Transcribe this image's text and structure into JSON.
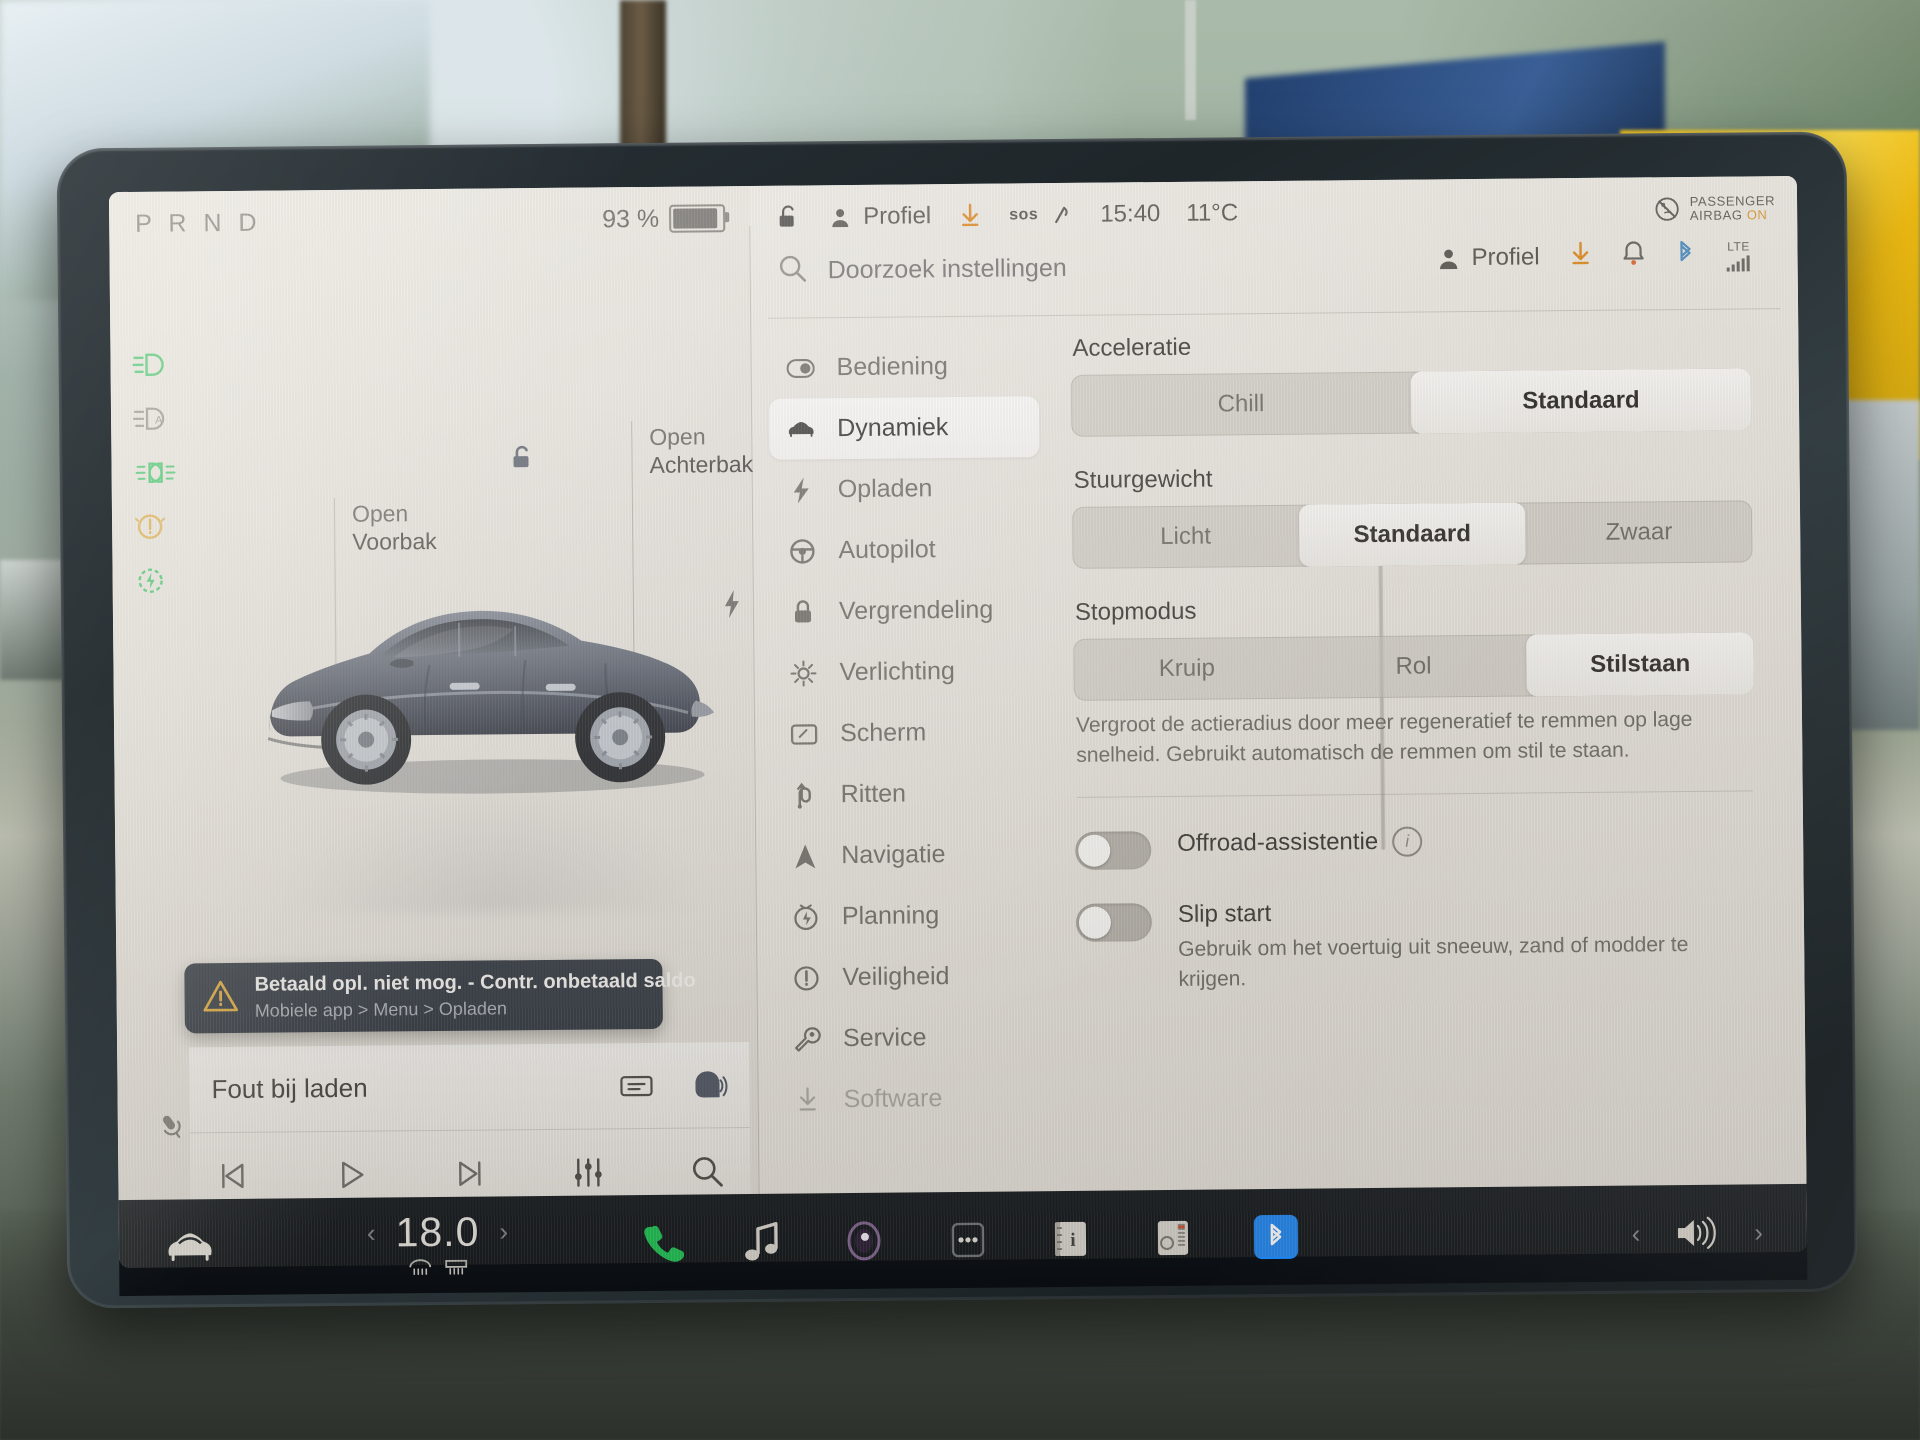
{
  "status_bar": {
    "gear_indicator": "P R N D",
    "battery_percent": "93 %",
    "profile_label": "Profiel",
    "sos_label": "sos",
    "time": "15:40",
    "temperature": "11°C",
    "airbag_line1": "PASSENGER",
    "airbag_line2": "AIRBAG",
    "airbag_state": "ON"
  },
  "car_view": {
    "front_trunk_line1": "Open",
    "front_trunk_line2": "Voorbak",
    "rear_trunk_line1": "Open",
    "rear_trunk_line2": "Achterbak"
  },
  "notification": {
    "title": "Betaald opl. niet mog. - Contr. onbetaald saldo",
    "subtitle": "Mobiele app > Menu > Opladen"
  },
  "media": {
    "title": "Fout bij laden",
    "controls": [
      "previous-track",
      "play",
      "next-track",
      "equalizer",
      "search"
    ]
  },
  "settings": {
    "search_placeholder": "Doorzoek instellingen",
    "profile_label": "Profiel",
    "network_label": "LTE",
    "menu_items": [
      {
        "label": "Bediening",
        "icon": "toggle-icon"
      },
      {
        "label": "Dynamiek",
        "icon": "car-icon"
      },
      {
        "label": "Opladen",
        "icon": "bolt-icon"
      },
      {
        "label": "Autopilot",
        "icon": "steering-wheel-icon"
      },
      {
        "label": "Vergrendeling",
        "icon": "lock-icon"
      },
      {
        "label": "Verlichting",
        "icon": "sun-icon"
      },
      {
        "label": "Scherm",
        "icon": "display-icon"
      },
      {
        "label": "Ritten",
        "icon": "road-icon"
      },
      {
        "label": "Navigatie",
        "icon": "navigation-arrow-icon"
      },
      {
        "label": "Planning",
        "icon": "schedule-icon"
      },
      {
        "label": "Veiligheid",
        "icon": "alert-circle-icon"
      },
      {
        "label": "Service",
        "icon": "wrench-icon"
      },
      {
        "label": "Software",
        "icon": "download-icon"
      }
    ],
    "active_menu_item": "Dynamiek",
    "groups": [
      {
        "label": "Acceleratie",
        "options": [
          "Chill",
          "Standaard"
        ],
        "selected": "Standaard"
      },
      {
        "label": "Stuurgewicht",
        "options": [
          "Licht",
          "Standaard",
          "Zwaar"
        ],
        "selected": "Standaard"
      },
      {
        "label": "Stopmodus",
        "options": [
          "Kruip",
          "Rol",
          "Stilstaan"
        ],
        "selected": "Stilstaan",
        "description": "Vergroot de actieradius door meer regeneratief te remmen op lage snelheid. Gebruikt automatisch de remmen om stil te staan."
      }
    ],
    "toggles": [
      {
        "label": "Offroad-assistentie",
        "state": "off",
        "has_info": true,
        "description": ""
      },
      {
        "label": "Slip start",
        "state": "off",
        "has_info": false,
        "description": "Gebruik om het voertuig uit sneeuw, zand of modder te krijgen."
      }
    ]
  },
  "dock": {
    "car_icon": "car-icon",
    "temperature": "18.0",
    "phone_icon": "phone-icon",
    "media_icon": "music-note-icon",
    "camera_icon": "dashcam-icon",
    "more_icon": "more-dots-icon",
    "manual_icon": "owners-manual-icon",
    "mixer_icon": "audio-mixer-icon",
    "bluetooth_icon": "bluetooth-icon",
    "volume_icon": "volume-icon"
  },
  "colors": {
    "bluetooth_blue": "#1b84f2",
    "phone_green": "#18c050",
    "warn_amber": "#e0a93a",
    "headlight_green": "#2ec45e"
  }
}
